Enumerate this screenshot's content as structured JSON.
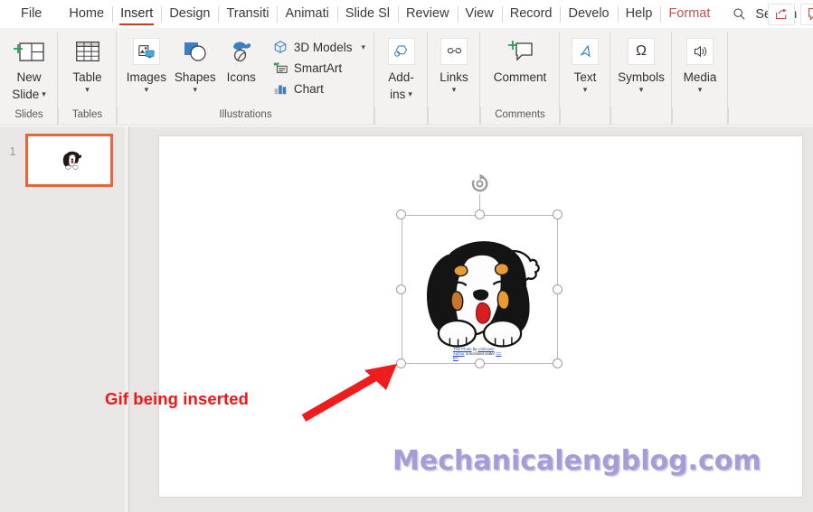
{
  "window": {
    "app": "PowerPoint"
  },
  "tabs": [
    {
      "label": "File",
      "active": false,
      "accent": false
    },
    {
      "label": "Home",
      "active": false,
      "accent": false
    },
    {
      "label": "Insert",
      "active": true,
      "accent": false
    },
    {
      "label": "Design",
      "active": false,
      "accent": false
    },
    {
      "label": "Transiti",
      "active": false,
      "accent": false
    },
    {
      "label": "Animati",
      "active": false,
      "accent": false
    },
    {
      "label": "Slide Sl",
      "active": false,
      "accent": false
    },
    {
      "label": "Review",
      "active": false,
      "accent": false
    },
    {
      "label": "View",
      "active": false,
      "accent": false
    },
    {
      "label": "Record",
      "active": false,
      "accent": false
    },
    {
      "label": "Develo",
      "active": false,
      "accent": false
    },
    {
      "label": "Help",
      "active": false,
      "accent": false
    },
    {
      "label": "Format",
      "active": false,
      "accent": true
    }
  ],
  "search": {
    "label": "Search",
    "icon": "search-icon"
  },
  "header_buttons": [
    {
      "name": "share-button",
      "icon": "share-icon"
    },
    {
      "name": "comments-button",
      "icon": "comments-icon"
    }
  ],
  "ribbon": {
    "groups": [
      {
        "name": "slides",
        "label": "Slides",
        "buttons": [
          {
            "label": "New\nSlide",
            "line1": "New",
            "line2": "Slide",
            "icon": "new-slide-icon",
            "has_chevron": true
          }
        ]
      },
      {
        "name": "tables",
        "label": "Tables",
        "buttons": [
          {
            "label": "Table",
            "line1": "Table",
            "line2": "",
            "icon": "table-icon",
            "has_chevron": true
          }
        ]
      },
      {
        "name": "illustrations",
        "label": "Illustrations",
        "buttons": [
          {
            "label": "Images",
            "line1": "Images",
            "line2": "",
            "icon": "images-icon",
            "has_chevron": true
          },
          {
            "label": "Shapes",
            "line1": "Shapes",
            "line2": "",
            "icon": "shapes-icon",
            "has_chevron": true
          },
          {
            "label": "Icons",
            "line1": "Icons",
            "line2": "",
            "icon": "icons-icon",
            "has_chevron": false
          }
        ],
        "small_buttons": [
          {
            "label": "3D Models",
            "icon": "cube-icon",
            "has_chevron": true
          },
          {
            "label": "SmartArt",
            "icon": "smartart-icon",
            "has_chevron": false
          },
          {
            "label": "Chart",
            "icon": "chart-icon",
            "has_chevron": false
          }
        ]
      },
      {
        "name": "addins",
        "label": "",
        "buttons": [
          {
            "label": "Add-ins",
            "line1": "Add-",
            "line2": "ins",
            "icon": "addins-icon",
            "has_chevron": true
          }
        ]
      },
      {
        "name": "links",
        "label": "",
        "buttons": [
          {
            "label": "Links",
            "line1": "Links",
            "line2": "",
            "icon": "links-icon",
            "has_chevron": true
          }
        ]
      },
      {
        "name": "comments",
        "label": "Comments",
        "buttons": [
          {
            "label": "Comment",
            "line1": "Comment",
            "line2": "",
            "icon": "comment-icon",
            "has_chevron": false
          }
        ]
      },
      {
        "name": "text",
        "label": "",
        "buttons": [
          {
            "label": "Text",
            "line1": "Text",
            "line2": "",
            "icon": "text-icon",
            "has_chevron": true
          }
        ]
      },
      {
        "name": "symbols",
        "label": "",
        "buttons": [
          {
            "label": "Symbols",
            "line1": "Symbols",
            "line2": "",
            "icon": "omega-icon",
            "has_chevron": true
          }
        ]
      },
      {
        "name": "media",
        "label": "",
        "buttons": [
          {
            "label": "Media",
            "line1": "Media",
            "line2": "",
            "icon": "speaker-icon",
            "has_chevron": true
          }
        ]
      }
    ]
  },
  "thumbnails": {
    "slides": [
      {
        "number": "1",
        "selected": true
      }
    ]
  },
  "slide": {
    "annotation": "Gif being inserted",
    "annotation_color": "#f01616",
    "watermark": "Mechanicalengblog.com",
    "watermark_color": "#a89cd6",
    "image": {
      "name": "bernese-puppy-gif",
      "attribution_prefix": "This Photo",
      "attribution_by": " by ",
      "attribution_author": "Unknown Author",
      "attribution_mid": " is licensed under ",
      "attribution_license": "CC BY",
      "full_attribution": "This Photo by Unknown Author is licensed under CC BY"
    },
    "selection": {
      "handle_count": 8,
      "rotate_handle": true,
      "border_color": "#b9b9b9"
    }
  }
}
